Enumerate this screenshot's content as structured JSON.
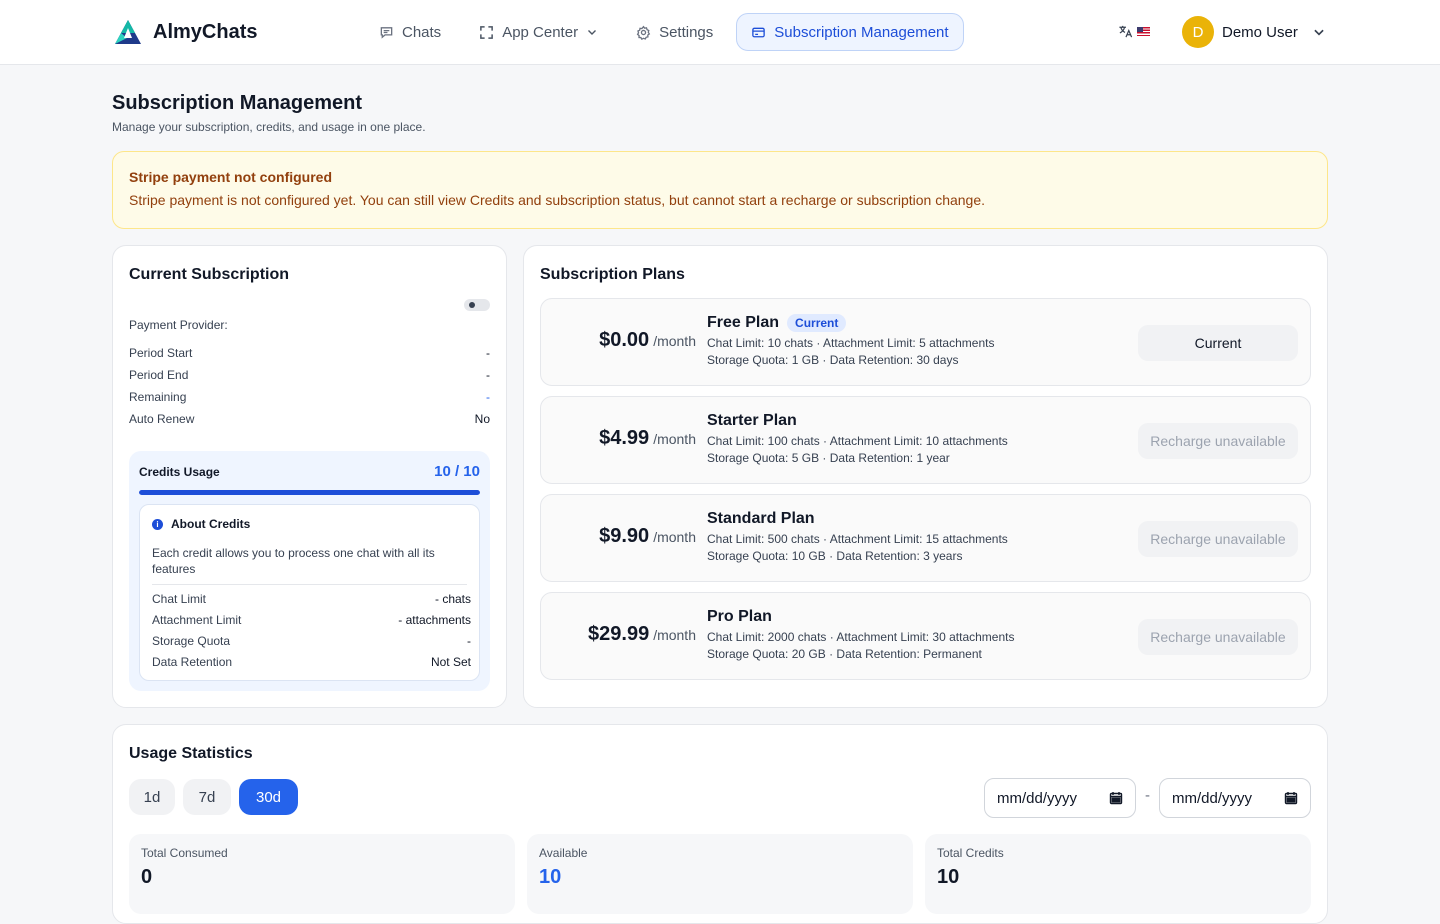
{
  "brand": {
    "name": "AlmyChats"
  },
  "nav": {
    "chats": "Chats",
    "app_center": "App Center",
    "settings": "Settings",
    "subscription": "Subscription Management"
  },
  "user": {
    "initial": "D",
    "name": "Demo User"
  },
  "page": {
    "title": "Subscription Management",
    "subtitle": "Manage your subscription, credits, and usage in one place."
  },
  "alert": {
    "title": "Stripe payment not configured",
    "text": "Stripe payment is not configured yet. You can still view Credits and subscription status, but cannot start a recharge or subscription change."
  },
  "current": {
    "title": "Current Subscription",
    "payment_provider_label": "Payment Provider:",
    "rows": [
      {
        "label": "Period Start",
        "value": "-"
      },
      {
        "label": "Period End",
        "value": "-"
      },
      {
        "label": "Remaining",
        "value": "-"
      },
      {
        "label": "Auto Renew",
        "value": "No"
      }
    ],
    "credits": {
      "label": "Credits Usage",
      "count": "10 / 10",
      "fill_fraction": 1.0,
      "about_title": "About Credits",
      "about_desc": "Each credit allows you to process one chat with all its features",
      "rows": [
        {
          "label": "Chat Limit",
          "value": "- chats"
        },
        {
          "label": "Attachment Limit",
          "value": "- attachments"
        },
        {
          "label": "Storage Quota",
          "value": "-"
        },
        {
          "label": "Data Retention",
          "value": "Not Set"
        }
      ]
    }
  },
  "plans": {
    "title": "Subscription Plans",
    "per": "/month",
    "items": [
      {
        "price": "$0.00",
        "name": "Free Plan",
        "badge": "Current",
        "line1": "Chat Limit: 10 chats · Attachment Limit: 5 attachments",
        "line2": "Storage Quota: 1 GB · Data Retention: 30 days",
        "button": "Current"
      },
      {
        "price": "$4.99",
        "name": "Starter Plan",
        "badge": "",
        "line1": "Chat Limit: 100 chats · Attachment Limit: 10 attachments",
        "line2": "Storage Quota: 5 GB · Data Retention: 1 year",
        "button": "Recharge unavailable"
      },
      {
        "price": "$9.90",
        "name": "Standard Plan",
        "badge": "",
        "line1": "Chat Limit: 500 chats · Attachment Limit: 15 attachments",
        "line2": "Storage Quota: 10 GB · Data Retention: 3 years",
        "button": "Recharge unavailable"
      },
      {
        "price": "$29.99",
        "name": "Pro Plan",
        "badge": "",
        "line1": "Chat Limit: 2000 chats · Attachment Limit: 30 attachments",
        "line2": "Storage Quota: 20 GB · Data Retention: Permanent",
        "button": "Recharge unavailable"
      }
    ]
  },
  "usage": {
    "title": "Usage Statistics",
    "ranges": [
      "1d",
      "7d",
      "30d"
    ],
    "active_range": "30d",
    "date_placeholder": "mm/dd/yyyy",
    "date_sep": "-",
    "stats": [
      {
        "label": "Total Consumed",
        "value": "0"
      },
      {
        "label": "Available",
        "value": "10"
      },
      {
        "label": "Total Credits",
        "value": "10"
      }
    ]
  },
  "colors": {
    "accent": "#2563eb",
    "alert_bg": "#fefbe8",
    "alert_text": "#92400e",
    "avatar": "#eab308"
  }
}
